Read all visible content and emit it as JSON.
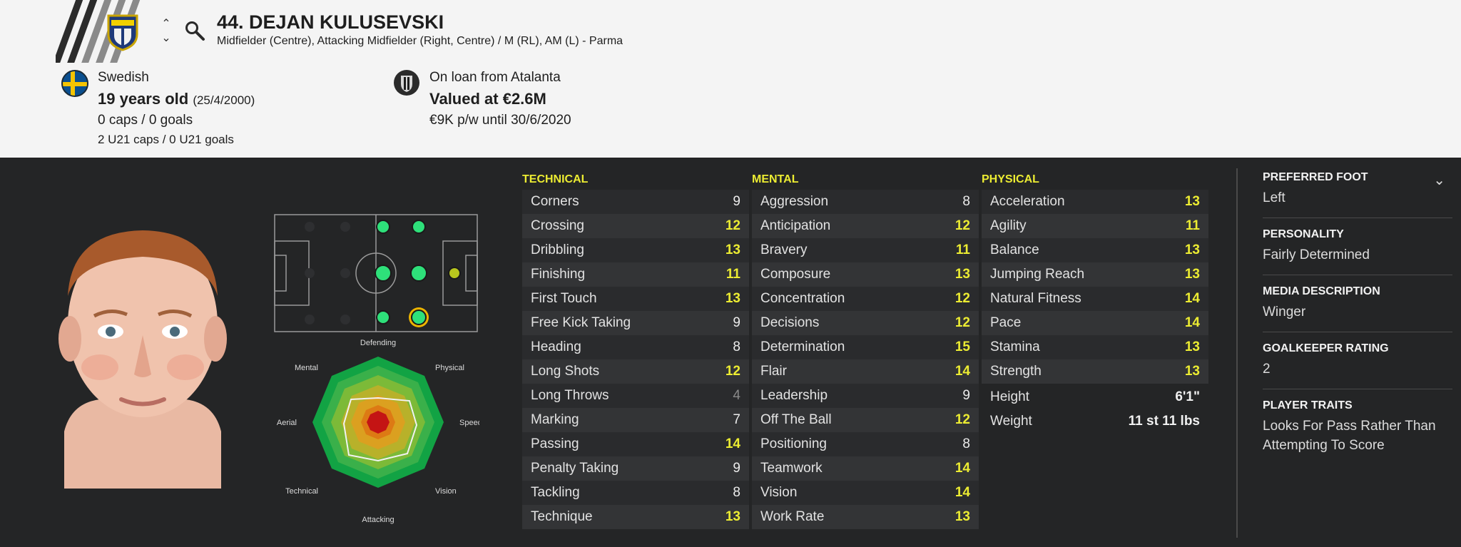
{
  "header": {
    "player_name": "44. DEJAN KULUSEVSKI",
    "positions": "Midfielder (Centre), Attacking Midfielder (Right, Centre) / M (RL), AM (L) - Parma",
    "nationality": "Swedish",
    "age": "19 years old",
    "dob": "(25/4/2000)",
    "caps": "0 caps / 0 goals",
    "u21_caps": "2 U21 caps / 0 U21 goals",
    "loan": "On loan from Atalanta",
    "value": "Valued at €2.6M",
    "wage": "€9K p/w until 30/6/2020",
    "badge_text": "PARMA CALCIO",
    "icons": {
      "arrows": "up-down-chevron-icon",
      "search": "search-icon",
      "flag": "sweden-flag-icon",
      "club": "atalanta-badge-icon"
    }
  },
  "radar": {
    "labels": [
      "Defending",
      "Physical",
      "Speed",
      "Vision",
      "Attacking",
      "Technical",
      "Aerial",
      "Mental"
    ]
  },
  "pitch": {
    "positions": [
      {
        "pos": "M (L)",
        "rating": "natural"
      },
      {
        "pos": "AM (L)",
        "rating": "natural"
      },
      {
        "pos": "M (C)",
        "rating": "natural"
      },
      {
        "pos": "AM (C)",
        "rating": "natural"
      },
      {
        "pos": "M (R)",
        "rating": "natural"
      },
      {
        "pos": "AM (R)",
        "rating": "natural",
        "selected": true
      },
      {
        "pos": "ST",
        "rating": "competent"
      }
    ]
  },
  "technical": {
    "title": "TECHNICAL",
    "rows": [
      {
        "label": "Corners",
        "value": "9"
      },
      {
        "label": "Crossing",
        "value": "12"
      },
      {
        "label": "Dribbling",
        "value": "13"
      },
      {
        "label": "Finishing",
        "value": "11"
      },
      {
        "label": "First Touch",
        "value": "13"
      },
      {
        "label": "Free Kick Taking",
        "value": "9"
      },
      {
        "label": "Heading",
        "value": "8"
      },
      {
        "label": "Long Shots",
        "value": "12"
      },
      {
        "label": "Long Throws",
        "value": "4"
      },
      {
        "label": "Marking",
        "value": "7"
      },
      {
        "label": "Passing",
        "value": "14"
      },
      {
        "label": "Penalty Taking",
        "value": "9"
      },
      {
        "label": "Tackling",
        "value": "8"
      },
      {
        "label": "Technique",
        "value": "13"
      }
    ]
  },
  "mental": {
    "title": "MENTAL",
    "rows": [
      {
        "label": "Aggression",
        "value": "8"
      },
      {
        "label": "Anticipation",
        "value": "12"
      },
      {
        "label": "Bravery",
        "value": "11"
      },
      {
        "label": "Composure",
        "value": "13"
      },
      {
        "label": "Concentration",
        "value": "12"
      },
      {
        "label": "Decisions",
        "value": "12"
      },
      {
        "label": "Determination",
        "value": "15"
      },
      {
        "label": "Flair",
        "value": "14"
      },
      {
        "label": "Leadership",
        "value": "9"
      },
      {
        "label": "Off The Ball",
        "value": "12"
      },
      {
        "label": "Positioning",
        "value": "8"
      },
      {
        "label": "Teamwork",
        "value": "14"
      },
      {
        "label": "Vision",
        "value": "14"
      },
      {
        "label": "Work Rate",
        "value": "13"
      }
    ]
  },
  "physical": {
    "title": "PHYSICAL",
    "rows": [
      {
        "label": "Acceleration",
        "value": "13"
      },
      {
        "label": "Agility",
        "value": "11"
      },
      {
        "label": "Balance",
        "value": "13"
      },
      {
        "label": "Jumping Reach",
        "value": "13"
      },
      {
        "label": "Natural Fitness",
        "value": "14"
      },
      {
        "label": "Pace",
        "value": "14"
      },
      {
        "label": "Stamina",
        "value": "13"
      },
      {
        "label": "Strength",
        "value": "13"
      }
    ],
    "height_label": "Height",
    "height_value": "6'1\"",
    "weight_label": "Weight",
    "weight_value": "11 st 11 lbs"
  },
  "side": {
    "foot_label": "PREFERRED FOOT",
    "foot_value": "Left",
    "personality_label": "PERSONALITY",
    "personality_value": "Fairly Determined",
    "media_label": "MEDIA DESCRIPTION",
    "media_value": "Winger",
    "gk_label": "GOALKEEPER RATING",
    "gk_value": "2",
    "traits_label": "PLAYER TRAITS",
    "traits_value": "Looks For Pass Rather Than Attempting To Score",
    "chevron_icon": "chevron-down-icon"
  },
  "colors": {
    "accent_yellow": "#ecec32",
    "panel_dark": "#242526",
    "header_bg": "#f4f4f4",
    "natural_green": "#2ee07a",
    "competent_yellow": "#b8c61e"
  }
}
